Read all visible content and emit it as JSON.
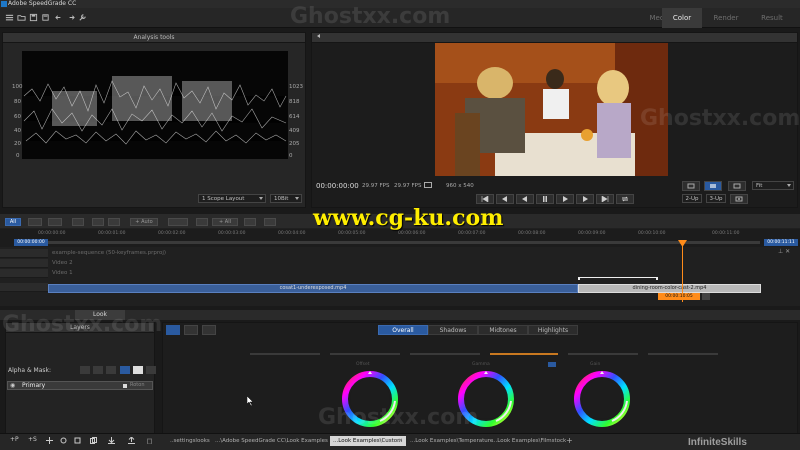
{
  "app": {
    "title": "Adobe SpeedGrade CC"
  },
  "tabs": [
    {
      "label": "Media",
      "active": false
    },
    {
      "label": "Color",
      "active": true
    },
    {
      "label": "Render",
      "active": false
    },
    {
      "label": "Result",
      "active": false
    }
  ],
  "watermark": {
    "text": "Ghostxx.com",
    "overlay_url": "www.cg-ku.com",
    "brand": "InfiniteSkills"
  },
  "analysis": {
    "title": "Analysis tools",
    "scale_left": [
      "100",
      "80",
      "60",
      "40",
      "20",
      "0"
    ],
    "scale_right": [
      "1023",
      "818",
      "614",
      "409",
      "205",
      "0"
    ],
    "layout_select": "1 Scope Layout",
    "bit_select": "10Bit"
  },
  "monitor": {
    "timecode": "00:00:00:00",
    "fps1": "29.97 FPS",
    "fps2": "29.97 FPS",
    "resolution": "960 x 540",
    "fit_select": "Fit",
    "view_2up": "2-Up",
    "view_3up": "3-Up"
  },
  "timeline": {
    "buttons": {
      "all": "All",
      "auto": "+ Auto",
      "add_all": "+ All"
    },
    "start_tc": "00:00:00:00",
    "end_tc": "00:00:11:11",
    "ruler": [
      "00:00:00:00",
      "00:00:01:00",
      "00:00:02:00",
      "00:00:03:00",
      "00:00:04:00",
      "00:00:05:00",
      "00:00:06:00",
      "00:00:07:00",
      "00:00:08:00",
      "00:00:09:00",
      "00:00:10:00",
      "00:00:11:00"
    ],
    "sequence": "example-sequence (50-keyframes.prproj)",
    "tracks": [
      "Video 2",
      "Video 1"
    ],
    "clip1": "cosat1-underexposed.mp4",
    "clip2": "dining-room-color-cast-2.mp4",
    "playhead_tc": "00:00:10:05"
  },
  "look": {
    "panel_title": "Look",
    "layers_title": "Layers",
    "alpha_mask": "Alpha & Mask:",
    "layer_name": "Primary",
    "layer_flag": "Roton",
    "grading_tabs": [
      {
        "label": "Overall",
        "active": true
      },
      {
        "label": "Shadows",
        "active": false
      },
      {
        "label": "Midtones",
        "active": false
      },
      {
        "label": "Highlights",
        "active": false
      }
    ],
    "wheel_labels": [
      "Offset",
      "Gamma",
      "Gain"
    ]
  },
  "bottom_tabs": [
    {
      "label": "..settingslooks",
      "active": false
    },
    {
      "label": "...\\Adobe SpeedGrade CC\\Look Examples",
      "active": false
    },
    {
      "label": "...Look Examples\\Custom",
      "active": true
    },
    {
      "label": "...Look Examples\\Temperature",
      "active": false
    },
    {
      "label": "...Look Examples\\Filmstock",
      "active": false
    }
  ],
  "bottom_tools": [
    "+P",
    "+S"
  ],
  "colors": {
    "accent": "#2a5aa0",
    "clip": "#3a5f9a",
    "playhead": "#ff8c1a"
  }
}
